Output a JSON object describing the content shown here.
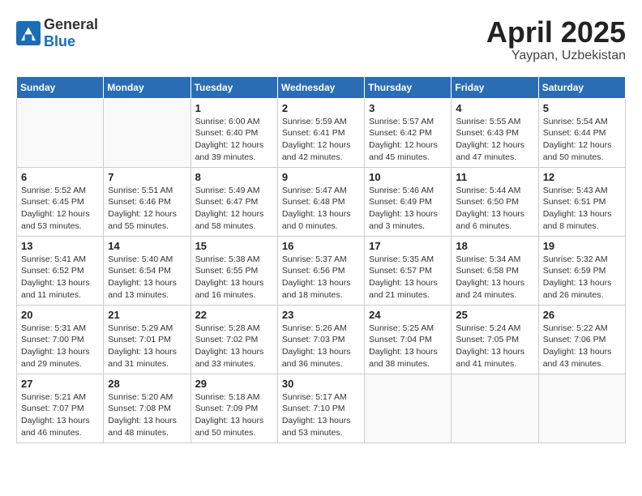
{
  "header": {
    "logo_general": "General",
    "logo_blue": "Blue",
    "month_title": "April 2025",
    "location": "Yaypan, Uzbekistan"
  },
  "weekdays": [
    "Sunday",
    "Monday",
    "Tuesday",
    "Wednesday",
    "Thursday",
    "Friday",
    "Saturday"
  ],
  "weeks": [
    [
      {
        "day": "",
        "detail": ""
      },
      {
        "day": "",
        "detail": ""
      },
      {
        "day": "1",
        "detail": "Sunrise: 6:00 AM\nSunset: 6:40 PM\nDaylight: 12 hours and 39 minutes."
      },
      {
        "day": "2",
        "detail": "Sunrise: 5:59 AM\nSunset: 6:41 PM\nDaylight: 12 hours and 42 minutes."
      },
      {
        "day": "3",
        "detail": "Sunrise: 5:57 AM\nSunset: 6:42 PM\nDaylight: 12 hours and 45 minutes."
      },
      {
        "day": "4",
        "detail": "Sunrise: 5:55 AM\nSunset: 6:43 PM\nDaylight: 12 hours and 47 minutes."
      },
      {
        "day": "5",
        "detail": "Sunrise: 5:54 AM\nSunset: 6:44 PM\nDaylight: 12 hours and 50 minutes."
      }
    ],
    [
      {
        "day": "6",
        "detail": "Sunrise: 5:52 AM\nSunset: 6:45 PM\nDaylight: 12 hours and 53 minutes."
      },
      {
        "day": "7",
        "detail": "Sunrise: 5:51 AM\nSunset: 6:46 PM\nDaylight: 12 hours and 55 minutes."
      },
      {
        "day": "8",
        "detail": "Sunrise: 5:49 AM\nSunset: 6:47 PM\nDaylight: 12 hours and 58 minutes."
      },
      {
        "day": "9",
        "detail": "Sunrise: 5:47 AM\nSunset: 6:48 PM\nDaylight: 13 hours and 0 minutes."
      },
      {
        "day": "10",
        "detail": "Sunrise: 5:46 AM\nSunset: 6:49 PM\nDaylight: 13 hours and 3 minutes."
      },
      {
        "day": "11",
        "detail": "Sunrise: 5:44 AM\nSunset: 6:50 PM\nDaylight: 13 hours and 6 minutes."
      },
      {
        "day": "12",
        "detail": "Sunrise: 5:43 AM\nSunset: 6:51 PM\nDaylight: 13 hours and 8 minutes."
      }
    ],
    [
      {
        "day": "13",
        "detail": "Sunrise: 5:41 AM\nSunset: 6:52 PM\nDaylight: 13 hours and 11 minutes."
      },
      {
        "day": "14",
        "detail": "Sunrise: 5:40 AM\nSunset: 6:54 PM\nDaylight: 13 hours and 13 minutes."
      },
      {
        "day": "15",
        "detail": "Sunrise: 5:38 AM\nSunset: 6:55 PM\nDaylight: 13 hours and 16 minutes."
      },
      {
        "day": "16",
        "detail": "Sunrise: 5:37 AM\nSunset: 6:56 PM\nDaylight: 13 hours and 18 minutes."
      },
      {
        "day": "17",
        "detail": "Sunrise: 5:35 AM\nSunset: 6:57 PM\nDaylight: 13 hours and 21 minutes."
      },
      {
        "day": "18",
        "detail": "Sunrise: 5:34 AM\nSunset: 6:58 PM\nDaylight: 13 hours and 24 minutes."
      },
      {
        "day": "19",
        "detail": "Sunrise: 5:32 AM\nSunset: 6:59 PM\nDaylight: 13 hours and 26 minutes."
      }
    ],
    [
      {
        "day": "20",
        "detail": "Sunrise: 5:31 AM\nSunset: 7:00 PM\nDaylight: 13 hours and 29 minutes."
      },
      {
        "day": "21",
        "detail": "Sunrise: 5:29 AM\nSunset: 7:01 PM\nDaylight: 13 hours and 31 minutes."
      },
      {
        "day": "22",
        "detail": "Sunrise: 5:28 AM\nSunset: 7:02 PM\nDaylight: 13 hours and 33 minutes."
      },
      {
        "day": "23",
        "detail": "Sunrise: 5:26 AM\nSunset: 7:03 PM\nDaylight: 13 hours and 36 minutes."
      },
      {
        "day": "24",
        "detail": "Sunrise: 5:25 AM\nSunset: 7:04 PM\nDaylight: 13 hours and 38 minutes."
      },
      {
        "day": "25",
        "detail": "Sunrise: 5:24 AM\nSunset: 7:05 PM\nDaylight: 13 hours and 41 minutes."
      },
      {
        "day": "26",
        "detail": "Sunrise: 5:22 AM\nSunset: 7:06 PM\nDaylight: 13 hours and 43 minutes."
      }
    ],
    [
      {
        "day": "27",
        "detail": "Sunrise: 5:21 AM\nSunset: 7:07 PM\nDaylight: 13 hours and 46 minutes."
      },
      {
        "day": "28",
        "detail": "Sunrise: 5:20 AM\nSunset: 7:08 PM\nDaylight: 13 hours and 48 minutes."
      },
      {
        "day": "29",
        "detail": "Sunrise: 5:18 AM\nSunset: 7:09 PM\nDaylight: 13 hours and 50 minutes."
      },
      {
        "day": "30",
        "detail": "Sunrise: 5:17 AM\nSunset: 7:10 PM\nDaylight: 13 hours and 53 minutes."
      },
      {
        "day": "",
        "detail": ""
      },
      {
        "day": "",
        "detail": ""
      },
      {
        "day": "",
        "detail": ""
      }
    ]
  ]
}
